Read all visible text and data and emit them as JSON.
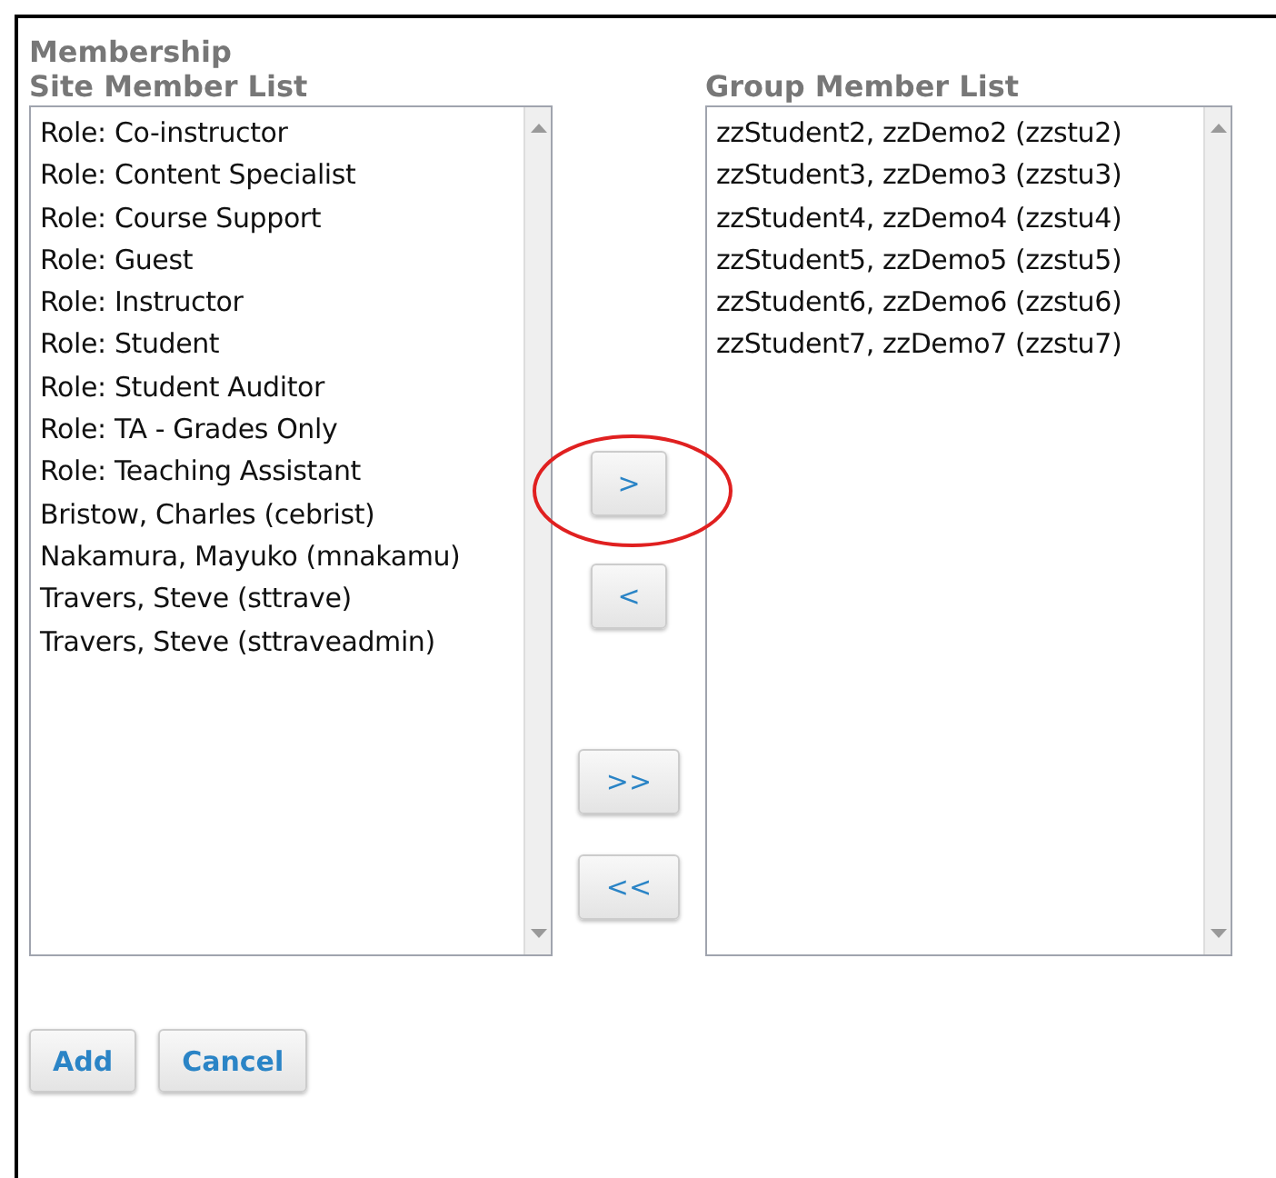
{
  "section_title": "Membership",
  "site_list": {
    "label": "Site Member List",
    "items": [
      "Role: Co-instructor",
      "Role: Content Specialist",
      "Role: Course Support",
      "Role: Guest",
      "Role: Instructor",
      "Role: Student",
      "Role: Student Auditor",
      "Role: TA - Grades Only",
      "Role: Teaching Assistant",
      "Bristow, Charles (cebrist)",
      "Nakamura, Mayuko (mnakamu)",
      "Travers, Steve (sttrave)",
      "Travers, Steve (sttraveadmin)"
    ]
  },
  "move_buttons": [
    ">",
    "<",
    ">>",
    "<<"
  ],
  "group_list": {
    "label": "Group Member List",
    "items": [
      "zzStudent2, zzDemo2 (zzstu2)",
      "zzStudent3, zzDemo3 (zzstu3)",
      "zzStudent4, zzDemo4 (zzstu4)",
      "zzStudent5, zzDemo5 (zzstu5)",
      "zzStudent6, zzDemo6 (zzstu6)",
      "zzStudent7, zzDemo7 (zzstu7)"
    ]
  },
  "actions": [
    "Add",
    "Cancel"
  ]
}
